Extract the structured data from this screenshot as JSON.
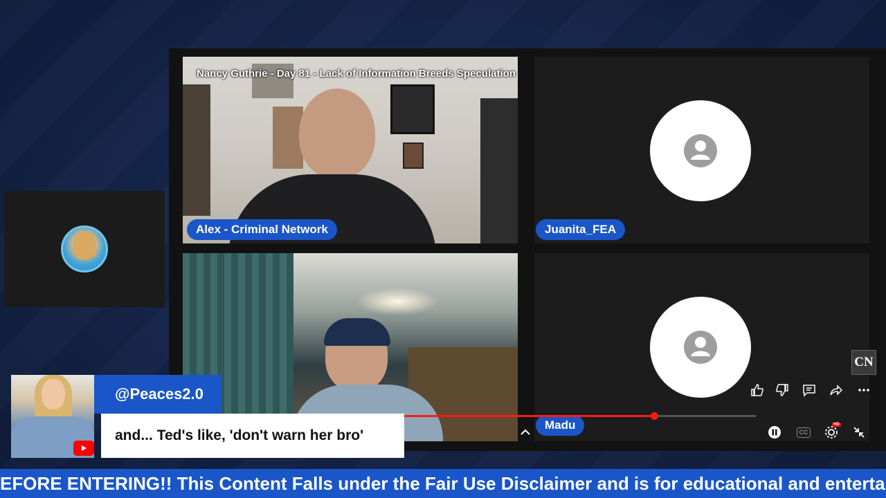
{
  "stream": {
    "title": "Nancy Guthrie - Day 81 - Lack of Information Breeds Speculation"
  },
  "participants": [
    {
      "name": "Alex - Criminal Network",
      "video": true
    },
    {
      "name": "Juanita_FEA",
      "video": false
    },
    {
      "name": "Madu",
      "video": false
    }
  ],
  "player": {
    "progress_fraction": 0.71,
    "controls": {
      "like": "thumbs-up-icon",
      "dislike": "thumbs-down-icon",
      "comment": "comment-icon",
      "share": "share-icon",
      "more": "more-options-icon",
      "pause": "pause-icon",
      "captions": "CC",
      "settings": "settings-gear-icon",
      "settings_badge": "HD",
      "exit_fullscreen": "exit-fullscreen-icon"
    }
  },
  "watermark": {
    "logo_text": "CN"
  },
  "comment": {
    "username": "@Peaces2.0",
    "text": "and... Ted's like, 'don't warn her bro'"
  },
  "ticker": {
    "text": "EFORE ENTERING!! This Content Falls under the Fair Use Disclaimer and is for educational and entertainme"
  },
  "colors": {
    "accent_blue": "#1a56c8",
    "background_navy": "#15264a",
    "progress_red": "#ff1a1a"
  }
}
